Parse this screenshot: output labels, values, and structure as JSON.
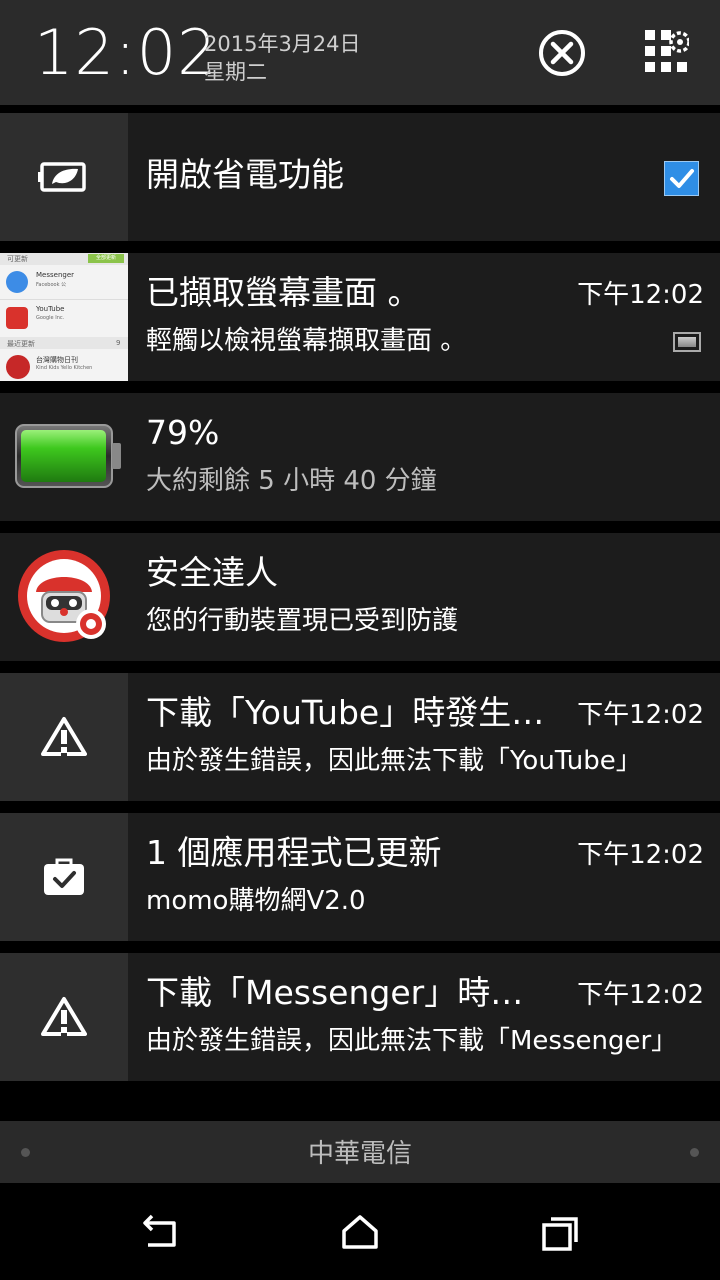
{
  "header": {
    "time": "12:02",
    "date": "2015年3月24日",
    "weekday": "星期二",
    "clear_icon": "close-circle-icon",
    "settings_icon": "quick-settings-icon"
  },
  "notifications": [
    {
      "id": "power-saver",
      "icon": "power-saver-icon",
      "title": "開啟省電功能",
      "checked": true
    },
    {
      "id": "screenshot",
      "title": "已擷取螢幕畫面 。",
      "subtitle": "輕觸以檢視螢幕擷取畫面 。",
      "time": "下午12:02",
      "thumb": {
        "section1": "可更新",
        "update_btn": "全部更新",
        "app1": "Messenger",
        "app1_sub": "Facebook 公",
        "app2": "YouTube",
        "app2_sub": "Google Inc.",
        "section2": "最近更新",
        "count": "9",
        "app3": "台灣購物日刊",
        "app3_sub": "Kind Kids Yello Kitchen"
      }
    },
    {
      "id": "battery",
      "icon": "battery-icon",
      "title": "79%",
      "subtitle": "大約剩餘 5 小時 40 分鐘",
      "level": 0.79
    },
    {
      "id": "security",
      "icon": "security-robot-icon",
      "title": "安全達人",
      "subtitle": "您的行動裝置現已受到防護"
    },
    {
      "id": "youtube-error",
      "icon": "warning-icon",
      "title": "下載「YouTube」時發生錯誤",
      "subtitle": "由於發生錯誤，因此無法下載「YouTube」",
      "time": "下午12:02"
    },
    {
      "id": "app-updated",
      "icon": "briefcase-check-icon",
      "title": "1 個應用程式已更新",
      "subtitle": "momo購物網V2.0",
      "time": "下午12:02"
    },
    {
      "id": "messenger-error",
      "icon": "warning-icon",
      "title": "下載「Messenger」時發生錯誤",
      "subtitle": "由於發生錯誤，因此無法下載「Messenger」",
      "time": "下午12:02"
    }
  ],
  "carrier": "中華電信",
  "navbar": {
    "back_icon": "back-icon",
    "home_icon": "home-icon",
    "recents_icon": "recents-icon"
  },
  "colors": {
    "battery_green": "#3ec81e",
    "checkbox_blue": "#2f8ee6",
    "security_red": "#d9322c"
  }
}
